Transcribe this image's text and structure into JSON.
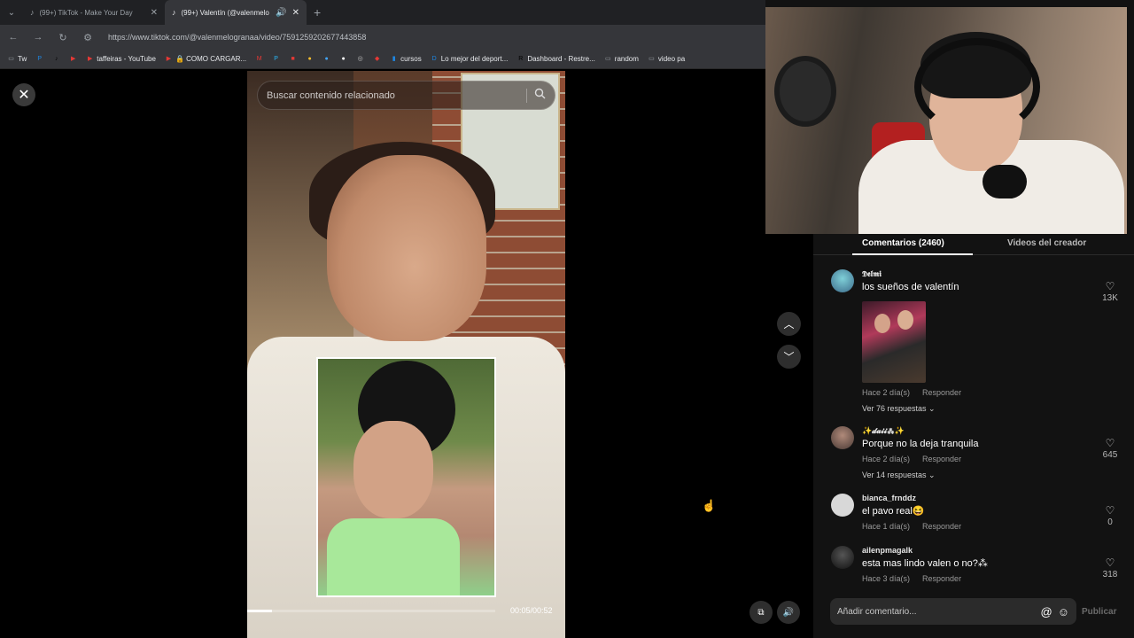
{
  "browser": {
    "tabs": [
      {
        "favicon": "tiktok-icon",
        "title": "(99+) TikTok - Make Your Day",
        "active": false
      },
      {
        "favicon": "tiktok-icon",
        "title": "(99+) Valentín (@valenmelo",
        "active": true
      }
    ],
    "url": "https://www.tiktok.com/@valenmelogranaa/video/7591259202677443858",
    "bookmarks": [
      {
        "icon": "folder-icon",
        "label": "Tw"
      },
      {
        "icon": "paypal-icon",
        "label": ""
      },
      {
        "icon": "tiktok-icon",
        "label": ""
      },
      {
        "icon": "youtube-icon",
        "label": ""
      },
      {
        "icon": "youtube-icon",
        "label": "taffeiras - YouTube"
      },
      {
        "icon": "youtube-icon",
        "label": "🔒 COMO CARGAR..."
      },
      {
        "icon": "gmail-icon",
        "label": ""
      },
      {
        "icon": "p-icon",
        "label": ""
      },
      {
        "icon": "red-icon",
        "label": ""
      },
      {
        "icon": "yellow-icon",
        "label": ""
      },
      {
        "icon": "blue-icon",
        "label": ""
      },
      {
        "icon": "white-icon",
        "label": ""
      },
      {
        "icon": "globe-icon",
        "label": ""
      },
      {
        "icon": "shield-icon",
        "label": ""
      },
      {
        "icon": "bookmark-icon",
        "label": "cursos"
      },
      {
        "icon": "d-icon",
        "label": "Lo mejor del deport..."
      },
      {
        "icon": "r-icon",
        "label": "Dashboard - Restre..."
      },
      {
        "icon": "folder-icon",
        "label": "random"
      },
      {
        "icon": "folder-icon",
        "label": "video pa"
      }
    ]
  },
  "video": {
    "search_placeholder": "Buscar contenido relacionado",
    "time": "00:05/00:52",
    "progress": 0.1
  },
  "panel": {
    "tab_comments": "Comentarios (2460)",
    "tab_creator": "Videos del creador",
    "comments": [
      {
        "user": "𝕯𝖊𝖑𝖒𝖎",
        "text": "los sueños de valentín",
        "time": "Hace 2 día(s)",
        "reply": "Responder",
        "likes": "13K",
        "replies": "Ver 76 respuestas ⌄",
        "has_image": true
      },
      {
        "user": "✨𝓭𝓪𝓲𝓲⁂✨",
        "text": "Porque no la deja tranquila",
        "time": "Hace 2 día(s)",
        "reply": "Responder",
        "likes": "645",
        "replies": "Ver 14 respuestas ⌄"
      },
      {
        "user": "bianca_frnddz",
        "text": "el pavo real😆",
        "time": "Hace 1 día(s)",
        "reply": "Responder",
        "likes": "0",
        "replies": ""
      },
      {
        "user": "ailenpmagalk",
        "text": "esta mas lindo valen o no?⁂",
        "time": "Hace 3 día(s)",
        "reply": "Responder",
        "likes": "318",
        "replies": ""
      }
    ],
    "composer_placeholder": "Añadir comentario...",
    "publish_label": "Publicar"
  }
}
